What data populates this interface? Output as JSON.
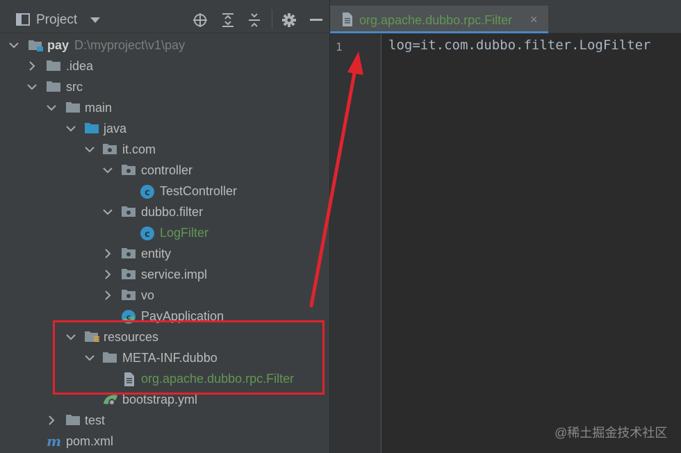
{
  "project_panel": {
    "title": "Project",
    "tree": [
      {
        "label": "pay",
        "path": "D:\\myproject\\v1\\pay"
      },
      {
        "label": ".idea"
      },
      {
        "label": "src"
      },
      {
        "label": "main"
      },
      {
        "label": "java"
      },
      {
        "label": "it.com"
      },
      {
        "label": "controller"
      },
      {
        "label": "TestController"
      },
      {
        "label": "dubbo.filter"
      },
      {
        "label": "LogFilter"
      },
      {
        "label": "entity"
      },
      {
        "label": "service.impl"
      },
      {
        "label": "vo"
      },
      {
        "label": "PayApplication"
      },
      {
        "label": "resources"
      },
      {
        "label": "META-INF.dubbo"
      },
      {
        "label": "org.apache.dubbo.rpc.Filter"
      },
      {
        "label": "bootstrap.yml"
      },
      {
        "label": "test"
      },
      {
        "label": "pom.xml"
      }
    ]
  },
  "editor": {
    "tab": {
      "label": "org.apache.dubbo.rpc.Filter",
      "close": "×"
    },
    "line_number": "1",
    "code": "log=it.com.dubbo.filter.LogFilter"
  },
  "watermark": "@稀土掘金技术社区",
  "colors": {
    "panel_bg": "#3c3f41",
    "editor_bg": "#2b2b2b",
    "text": "#bbbbbb",
    "modified_green": "#629755",
    "annotation_red": "#e0242e"
  }
}
